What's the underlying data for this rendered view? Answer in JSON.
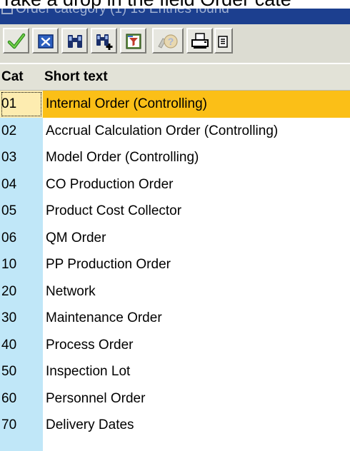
{
  "caption": {
    "text": "Take a drop in the field Order cate"
  },
  "dialog": {
    "title": "Order category (1)   13 Entries found"
  },
  "toolbar": {
    "buttons": [
      {
        "name": "continue-button",
        "icon": "checkmark-icon"
      },
      {
        "name": "cancel-button",
        "icon": "close-icon"
      },
      {
        "name": "find-button",
        "icon": "binoculars-icon"
      },
      {
        "name": "find-next-button",
        "icon": "binoculars-plus-icon"
      },
      {
        "name": "restrict-values-button",
        "icon": "filter-icon"
      },
      {
        "name": "help-button",
        "icon": "help-icon"
      },
      {
        "name": "print-button",
        "icon": "printer-icon"
      },
      {
        "name": "settings-button",
        "icon": "list-settings-icon"
      }
    ]
  },
  "colors": {
    "title_bg": "#1c3f8f",
    "key_column_bg": "#c0e7f8",
    "selected_row_bg": "#fbbf17"
  },
  "table": {
    "columns": {
      "key": "Cat",
      "text": "Short text"
    },
    "selected_index": 0,
    "rows": [
      {
        "key": "01",
        "text": "Internal Order (Controlling)"
      },
      {
        "key": "02",
        "text": "Accrual Calculation Order (Controlling)"
      },
      {
        "key": "03",
        "text": "Model Order (Controlling)"
      },
      {
        "key": "04",
        "text": "CO Production Order"
      },
      {
        "key": "05",
        "text": "Product Cost Collector"
      },
      {
        "key": "06",
        "text": "QM Order"
      },
      {
        "key": "10",
        "text": "PP Production Order"
      },
      {
        "key": "20",
        "text": "Network"
      },
      {
        "key": "30",
        "text": "Maintenance Order"
      },
      {
        "key": "40",
        "text": "Process Order"
      },
      {
        "key": "50",
        "text": "Inspection Lot"
      },
      {
        "key": "60",
        "text": "Personnel Order"
      },
      {
        "key": "70",
        "text": "Delivery Dates"
      }
    ]
  }
}
